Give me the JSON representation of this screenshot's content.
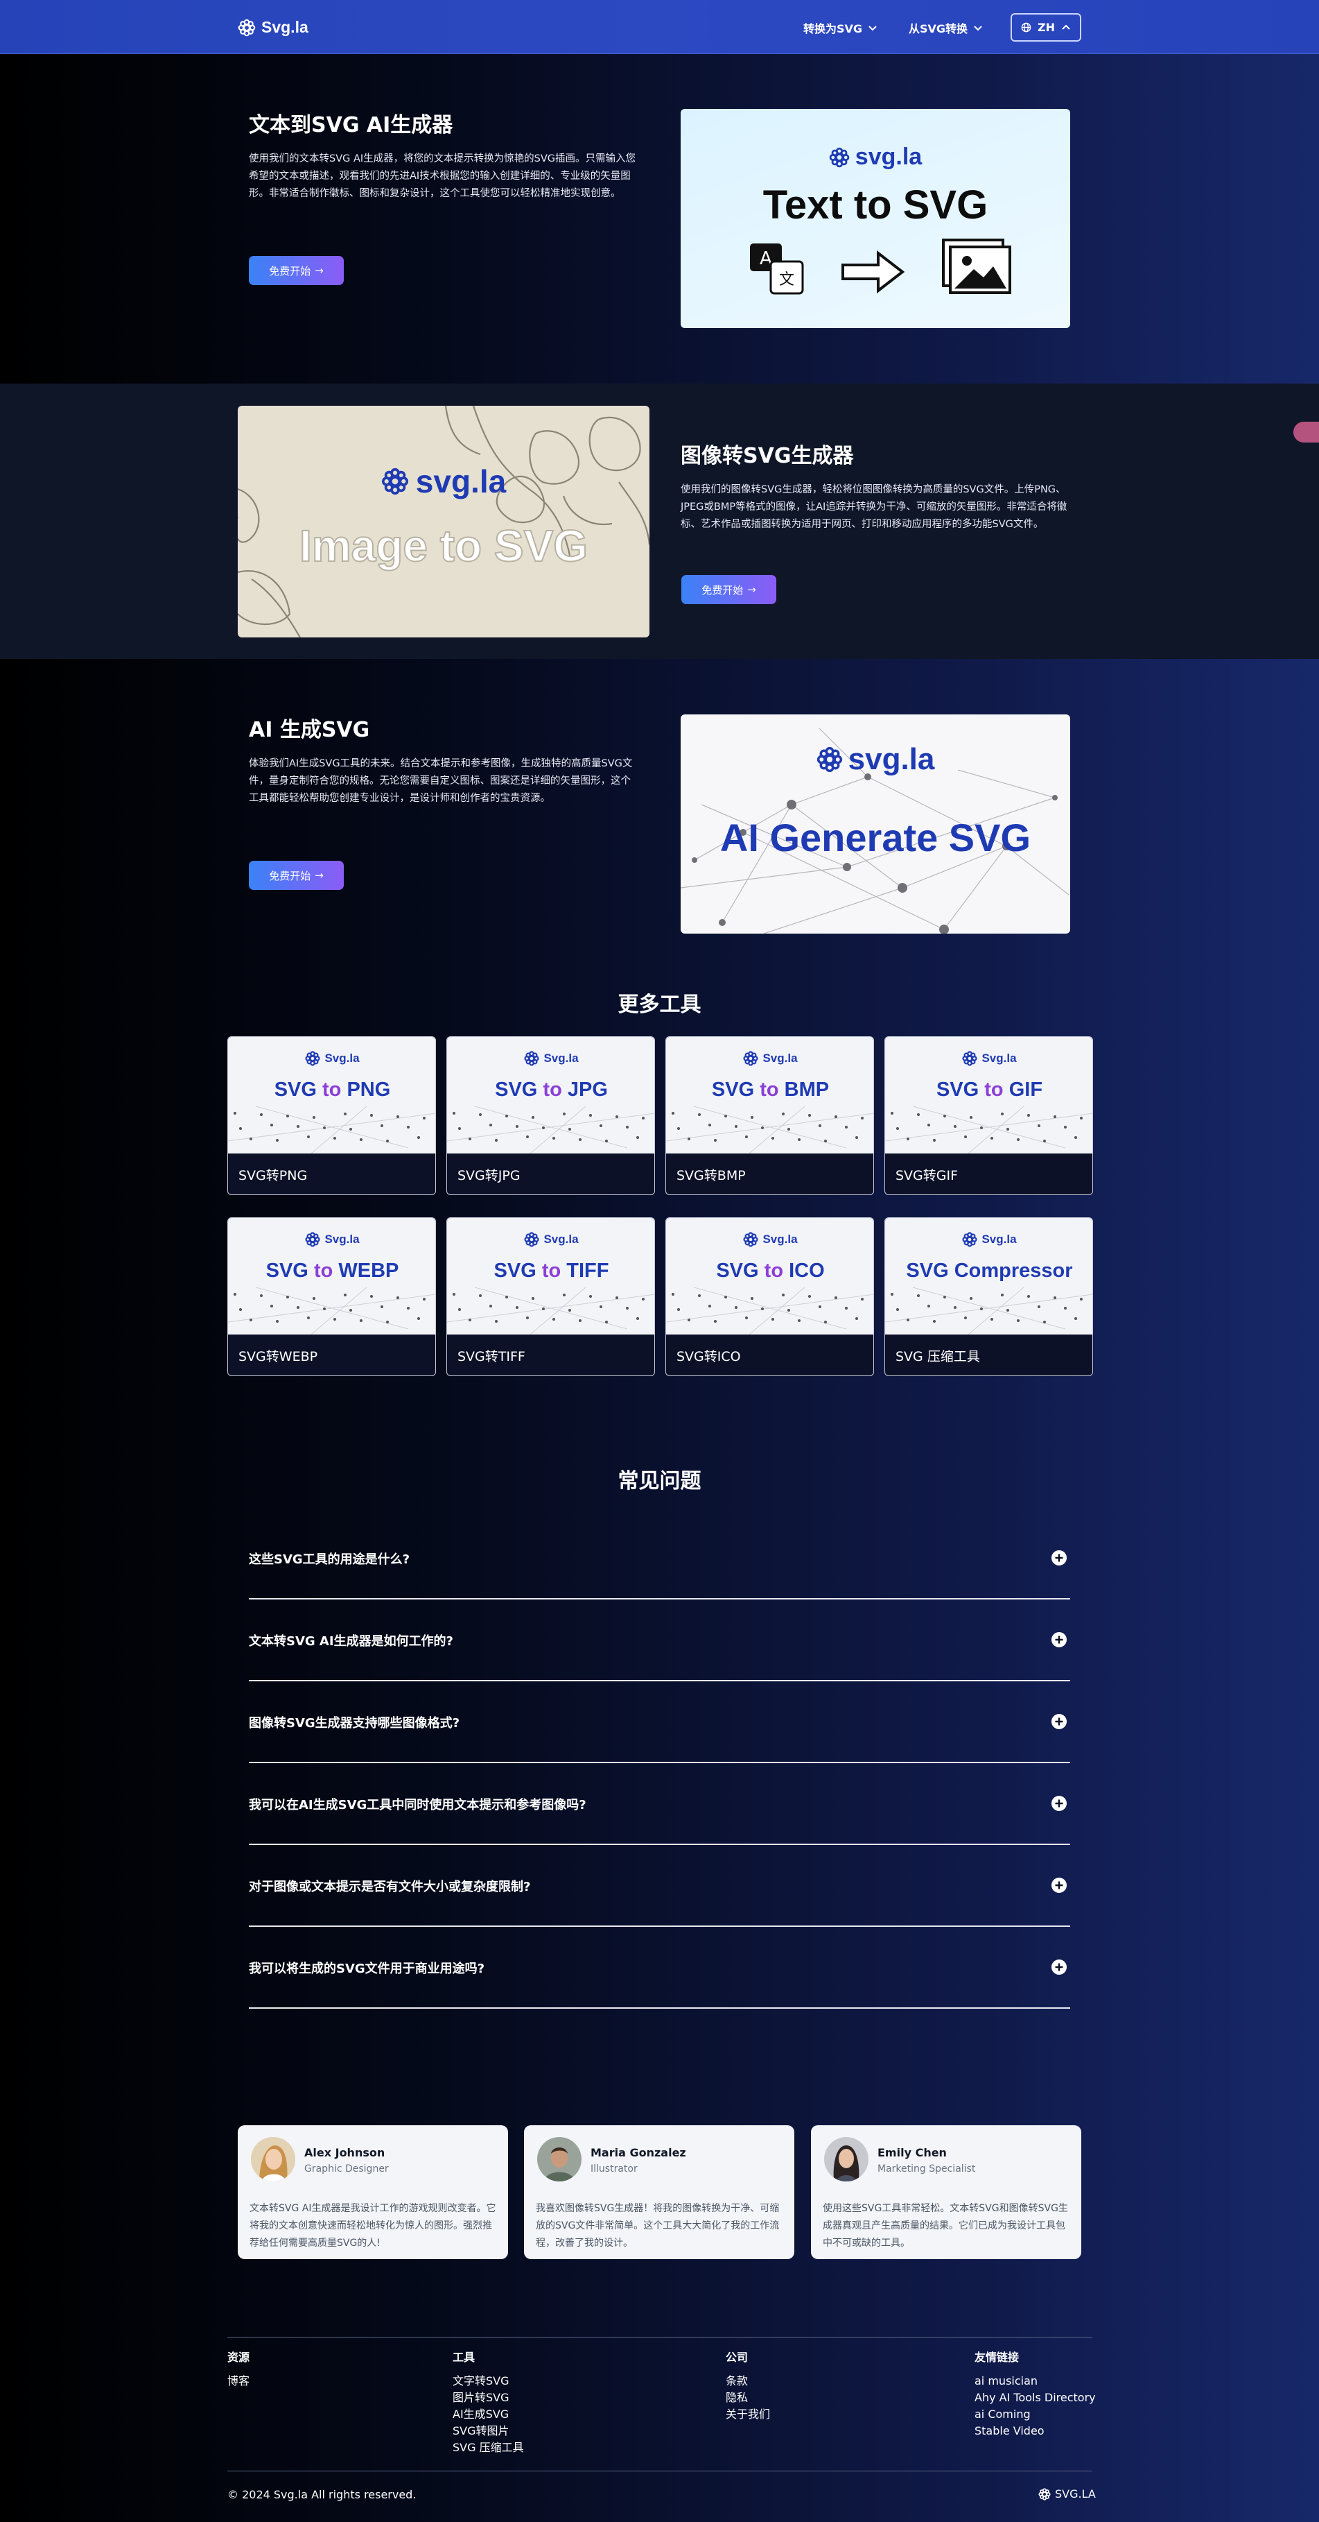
{
  "nav": {
    "brand": "Svg.la",
    "to_svg": "转换为SVG",
    "from_svg": "从SVG转换",
    "lang": "ZH"
  },
  "features": [
    {
      "title": "文本到SVG AI生成器",
      "desc": "使用我们的文本转SVG AI生成器，将您的文本提示转换为惊艳的SVG插画。只需输入您希望的文本或描述，观看我们的先进AI技术根据您的输入创建详细的、专业级的矢量图形。非常适合制作徽标、图标和复杂设计，这个工具使您可以轻松精准地实现创意。",
      "cta": "免费开始",
      "hero_brand": "svg.la",
      "hero_title": "Text to SVG"
    },
    {
      "title": "图像转SVG生成器",
      "desc": "使用我们的图像转SVG生成器，轻松将位图图像转换为高质量的SVG文件。上传PNG、JPEG或BMP等格式的图像，让AI追踪并转换为干净、可缩放的矢量图形。非常适合将徽标、艺术作品或插图转换为适用于网页、打印和移动应用程序的多功能SVG文件。",
      "cta": "免费开始",
      "hero_brand": "svg.la",
      "hero_title": "Image to SVG"
    },
    {
      "title": "AI 生成SVG",
      "desc": "体验我们AI生成SVG工具的未来。结合文本提示和参考图像，生成独特的高质量SVG文件，量身定制符合您的规格。无论您需要自定义图标、图案还是详细的矢量图形，这个工具都能轻松帮助您创建专业设计，是设计师和创作者的宝贵资源。",
      "cta": "免费开始",
      "hero_brand": "svg.la",
      "hero_title": "AI Generate SVG"
    }
  ],
  "more_tools": {
    "title": "更多工具",
    "items": [
      {
        "label": "SVG转PNG",
        "banner_a": "SVG",
        "banner_to": "to",
        "banner_b": "PNG",
        "brand": "Svg.la"
      },
      {
        "label": "SVG转JPG",
        "banner_a": "SVG",
        "banner_to": "to",
        "banner_b": "JPG",
        "brand": "Svg.la"
      },
      {
        "label": "SVG转BMP",
        "banner_a": "SVG",
        "banner_to": "to",
        "banner_b": "BMP",
        "brand": "Svg.la"
      },
      {
        "label": "SVG转GIF",
        "banner_a": "SVG",
        "banner_to": "to",
        "banner_b": "GIF",
        "brand": "Svg.la"
      },
      {
        "label": "SVG转WEBP",
        "banner_a": "SVG",
        "banner_to": "to",
        "banner_b": "WEBP",
        "brand": "Svg.la"
      },
      {
        "label": "SVG转TIFF",
        "banner_a": "SVG",
        "banner_to": "to",
        "banner_b": "TIFF",
        "brand": "Svg.la"
      },
      {
        "label": "SVG转ICO",
        "banner_a": "SVG",
        "banner_to": "to",
        "banner_b": "ICO",
        "brand": "Svg.la"
      },
      {
        "label": "SVG 压缩工具",
        "banner_a": "SVG Compressor",
        "banner_to": "",
        "banner_b": "",
        "brand": "Svg.la"
      }
    ]
  },
  "faq": {
    "title": "常见问题",
    "items": [
      "这些SVG工具的用途是什么?",
      "文本转SVG AI生成器是如何工作的?",
      "图像转SVG生成器支持哪些图像格式?",
      "我可以在AI生成SVG工具中同时使用文本提示和参考图像吗?",
      "对于图像或文本提示是否有文件大小或复杂度限制?",
      "我可以将生成的SVG文件用于商业用途吗?"
    ]
  },
  "testimonials": [
    {
      "name": "Alex Johnson",
      "role": "Graphic Designer",
      "text": "文本转SVG AI生成器是我设计工作的游戏规则改变者。它将我的文本创意快速而轻松地转化为惊人的图形。强烈推荐给任何需要高质量SVG的人!"
    },
    {
      "name": "Maria Gonzalez",
      "role": "Illustrator",
      "text": "我喜欢图像转SVG生成器！将我的图像转换为干净、可缩放的SVG文件非常简单。这个工具大大简化了我的工作流程，改善了我的设计。"
    },
    {
      "name": "Emily Chen",
      "role": "Marketing Specialist",
      "text": "使用这些SVG工具非常轻松。文本转SVG和图像转SVG生成器真观且产生高质量的结果。它们已成为我设计工具包中不可或缺的工具。"
    }
  ],
  "footer": {
    "resources": {
      "title": "资源",
      "links": [
        "博客"
      ]
    },
    "tools": {
      "title": "工具",
      "links": [
        "文字转SVG",
        "图片转SVG",
        "AI生成SVG",
        "SVG转图片",
        "SVG 压缩工具"
      ]
    },
    "company": {
      "title": "公司",
      "links": [
        "条款",
        "隐私",
        "关于我们"
      ]
    },
    "friends": {
      "title": "友情链接",
      "links": [
        "ai musician",
        "Ahy AI Tools Directory",
        "ai Coming",
        "Stable Video"
      ]
    },
    "copyright": "© 2024 Svg.la All rights reserved.",
    "brand": "SVG.LA"
  },
  "colors": {
    "nav": "#2a47be",
    "brand_blue": "#1f3bb3",
    "accent_purple": "#8b5cf6",
    "cta_blue": "#3b82f6"
  }
}
